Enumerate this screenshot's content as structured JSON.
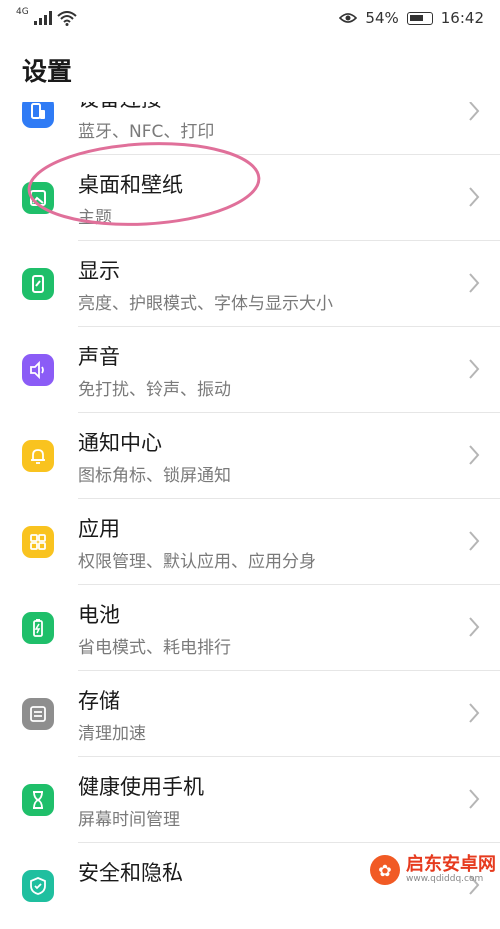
{
  "status_bar": {
    "network_type": "4G",
    "battery_percent": "54%",
    "time": "16:42"
  },
  "page": {
    "title": "设置"
  },
  "items": [
    {
      "title": "设备连接",
      "subtitle": "蓝牙、NFC、打印",
      "icon": "device-connect-icon",
      "color": "#2f7bf5"
    },
    {
      "title": "桌面和壁纸",
      "subtitle": "主题",
      "icon": "wallpaper-icon",
      "color": "#1fbf6a"
    },
    {
      "title": "显示",
      "subtitle": "亮度、护眼模式、字体与显示大小",
      "icon": "display-icon",
      "color": "#1fbf6a"
    },
    {
      "title": "声音",
      "subtitle": "免打扰、铃声、振动",
      "icon": "sound-icon",
      "color": "#8b5cf6"
    },
    {
      "title": "通知中心",
      "subtitle": "图标角标、锁屏通知",
      "icon": "bell-icon",
      "color": "#f9c31f"
    },
    {
      "title": "应用",
      "subtitle": "权限管理、默认应用、应用分身",
      "icon": "apps-grid-icon",
      "color": "#f9c31f"
    },
    {
      "title": "电池",
      "subtitle": "省电模式、耗电排行",
      "icon": "battery-icon",
      "color": "#1fbf6a"
    },
    {
      "title": "存储",
      "subtitle": "清理加速",
      "icon": "storage-icon",
      "color": "#8e8e8e"
    },
    {
      "title": "健康使用手机",
      "subtitle": "屏幕时间管理",
      "icon": "hourglass-icon",
      "color": "#1fbf6a"
    },
    {
      "title": "安全和隐私",
      "subtitle": "",
      "icon": "shield-icon",
      "color": "#1fbf9f"
    }
  ],
  "annotation": {
    "color": "#e0709a"
  },
  "watermark": {
    "name": "启东安卓网",
    "url": "www.qdiddq.com"
  }
}
